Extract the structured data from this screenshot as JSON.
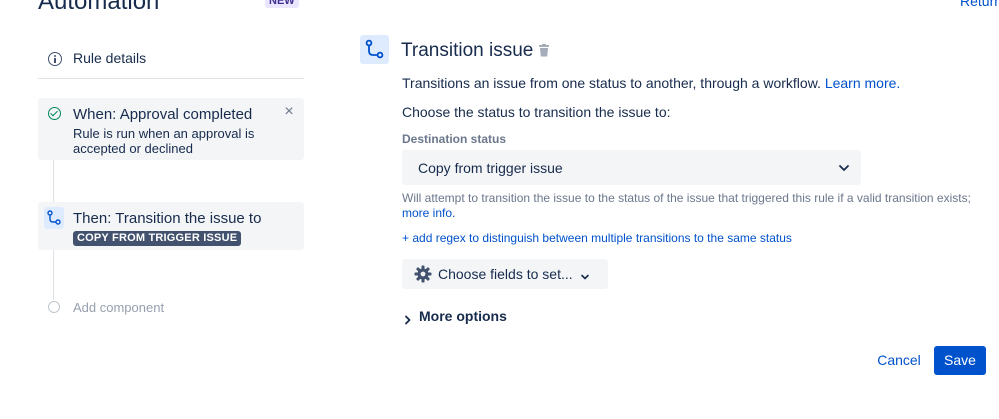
{
  "header": {
    "title": "Automation",
    "badge": "NEW",
    "return_link": "Return"
  },
  "sidebar": {
    "rule_details_label": "Rule details",
    "trigger": {
      "title": "When: Approval completed",
      "description": "Rule is run when an approval is accepted or declined",
      "close_icon": "×"
    },
    "action": {
      "title": "Then: Transition the issue to",
      "lozenge": "COPY FROM TRIGGER ISSUE"
    },
    "add_component_label": "Add component"
  },
  "panel": {
    "title": "Transition issue",
    "description": "Transitions an issue from one status to another, through a workflow. ",
    "learn_more": "Learn more.",
    "choose_label": "Choose the status to transition the issue to:",
    "destination_label": "Destination status",
    "destination_value": "Copy from trigger issue",
    "helper_text": "Will attempt to transition the issue to the status of the issue that triggered this rule if a valid transition exists; ",
    "helper_link": "more info.",
    "regex_link": "+ add regex to distinguish between multiple transitions to the same status",
    "choose_fields_label": "Choose fields to set...",
    "more_options_label": "More options",
    "cancel_label": "Cancel",
    "save_label": "Save"
  },
  "icons": {
    "info": "info-icon",
    "check": "check-circle-icon",
    "close": "close-icon",
    "transition": "transition-icon",
    "trash": "trash-icon",
    "chevron_down": "chevron-down-icon",
    "gear": "gear-icon",
    "chevron_right": "chevron-right-icon"
  },
  "colors": {
    "primary": "#0052CC",
    "text": "#172B4D",
    "subtle": "#6B778C",
    "success": "#00875A",
    "card_bg": "#F4F5F7",
    "icon_bg": "#DEEBFF"
  }
}
